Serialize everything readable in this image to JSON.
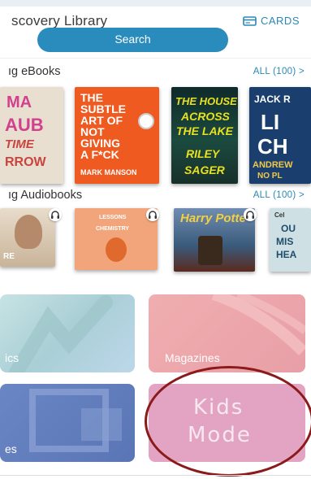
{
  "header": {
    "title": "scovery Library",
    "cards_label": "CARDS",
    "search_label": "Search"
  },
  "ebooks": {
    "title": "ıg eBooks",
    "all_label": "ALL (100) >",
    "books": [
      {
        "lines": [
          "MA",
          "AUB",
          "TIME",
          "RROW"
        ]
      },
      {
        "lines": [
          "THE",
          "SUBTLE",
          "ART OF",
          "NOT",
          "GIVING",
          "A F*CK",
          "MARK MANSON"
        ]
      },
      {
        "lines": [
          "THE HOUSE",
          "ACROSS",
          "THE LAKE",
          "RILEY",
          "SAGER"
        ]
      },
      {
        "lines": [
          "JACK R",
          "LI",
          "CH",
          "ANDREW",
          "NO PL"
        ]
      }
    ]
  },
  "audiobooks": {
    "title": "ıg Audiobooks",
    "all_label": "ALL (100) >",
    "books": [
      {
        "lines": [
          "RE"
        ]
      },
      {
        "lines": [
          "LESSONS",
          "CHEMISTRY"
        ]
      },
      {
        "lines": [
          "Harry Potte"
        ]
      },
      {
        "lines": [
          "Cel",
          "OU",
          "MIS",
          "HEA"
        ]
      }
    ]
  },
  "tiles": {
    "comics": "ics",
    "magazines": "Magazines",
    "movies": "es",
    "kids_line1": "Kids",
    "kids_line2": "Mode"
  },
  "colors": {
    "accent": "#2a8cbd",
    "annotation": "#8b1a1a"
  }
}
